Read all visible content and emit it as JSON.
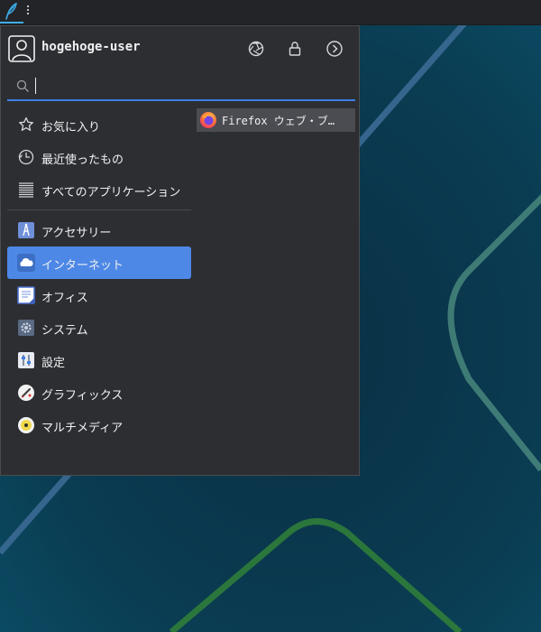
{
  "user": {
    "name": "hogehoge-user"
  },
  "search": {
    "value": "",
    "placeholder": ""
  },
  "categories": [
    {
      "label": "お気に入り",
      "icon": "star-icon"
    },
    {
      "label": "最近使ったもの",
      "icon": "recent-clock-icon"
    },
    {
      "label": "すべてのアプリケーション",
      "icon": "all-apps-icon"
    },
    {
      "label": "アクセサリー",
      "icon": "accessories-icon"
    },
    {
      "label": "インターネット",
      "icon": "cloud-icon",
      "active": true
    },
    {
      "label": "オフィス",
      "icon": "office-icon"
    },
    {
      "label": "システム",
      "icon": "system-gear-icon"
    },
    {
      "label": "設定",
      "icon": "settings-sliders-icon"
    },
    {
      "label": "グラフィックス",
      "icon": "graphics-brush-icon"
    },
    {
      "label": "マルチメディア",
      "icon": "multimedia-disc-icon"
    }
  ],
  "apps": [
    {
      "label": "Firefox ウェブ・ブラウザー",
      "display": "Firefox ウェブ・ブ…",
      "icon": "firefox-icon"
    }
  ],
  "colors": {
    "accent": "#4d88e6",
    "panel": "#232427",
    "menu_bg": "#2d2e32",
    "text": "#eff0f1"
  }
}
